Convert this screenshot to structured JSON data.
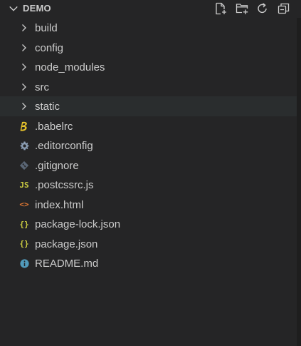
{
  "explorer": {
    "title": "DEMO",
    "title_icon": "chevron-down-icon",
    "actions": [
      {
        "name": "new-file-button",
        "icon": "new-file-icon"
      },
      {
        "name": "new-folder-button",
        "icon": "new-folder-icon"
      },
      {
        "name": "refresh-button",
        "icon": "refresh-icon"
      },
      {
        "name": "collapse-all-button",
        "icon": "collapse-all-icon"
      }
    ]
  },
  "tree": {
    "items": [
      {
        "label": "build",
        "type": "folder",
        "icon": "chevron-right-icon"
      },
      {
        "label": "config",
        "type": "folder",
        "icon": "chevron-right-icon"
      },
      {
        "label": "node_modules",
        "type": "folder",
        "icon": "chevron-right-icon"
      },
      {
        "label": "src",
        "type": "folder",
        "icon": "chevron-right-icon"
      },
      {
        "label": "static",
        "type": "folder",
        "icon": "chevron-right-icon",
        "hovered": true
      },
      {
        "label": ".babelrc",
        "type": "file",
        "icon": "babel-icon",
        "color": "#e8c32b"
      },
      {
        "label": ".editorconfig",
        "type": "file",
        "icon": "gear-icon",
        "color": "#8b9db3"
      },
      {
        "label": ".gitignore",
        "type": "file",
        "icon": "git-icon",
        "color": "#5a6675"
      },
      {
        "label": ".postcssrc.js",
        "type": "file",
        "icon": "javascript-icon",
        "color": "#cbcb41",
        "glyph": "JS"
      },
      {
        "label": "index.html",
        "type": "file",
        "icon": "html-icon",
        "color": "#e37933",
        "glyph": "<>"
      },
      {
        "label": "package-lock.json",
        "type": "file",
        "icon": "json-icon",
        "color": "#cbcb41",
        "glyph": "{}"
      },
      {
        "label": "package.json",
        "type": "file",
        "icon": "json-icon",
        "color": "#cbcb41",
        "glyph": "{}"
      },
      {
        "label": "README.md",
        "type": "file",
        "icon": "info-icon",
        "color": "#519aba"
      }
    ]
  },
  "colors": {
    "background": "#252526",
    "hover_row": "#2a2d2e",
    "text": "#cccccc"
  }
}
